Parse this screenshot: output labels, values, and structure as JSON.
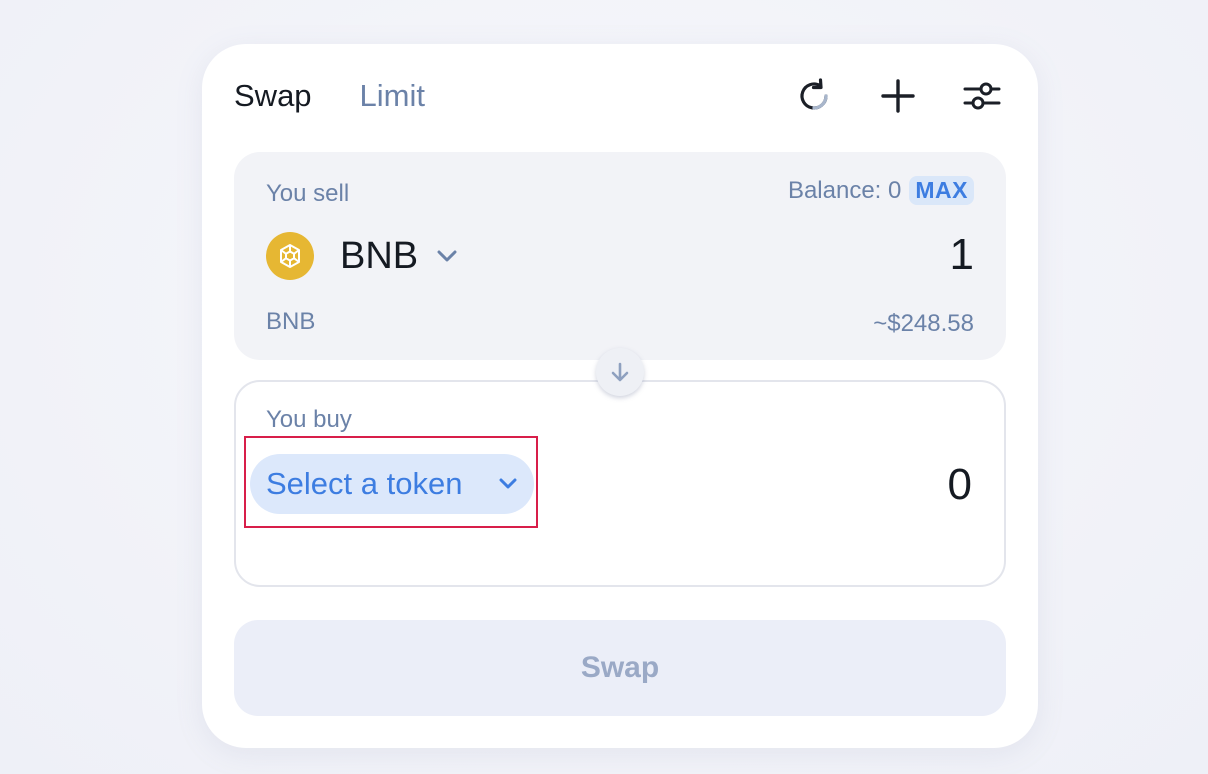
{
  "tabs": [
    {
      "label": "Swap",
      "active": true
    },
    {
      "label": "Limit",
      "active": false
    }
  ],
  "toolbar": {
    "icons": [
      "refresh-icon",
      "plus-icon",
      "settings-sliders-icon"
    ]
  },
  "sell": {
    "label": "You sell",
    "balance_text": "Balance: 0",
    "max_label": "MAX",
    "token_symbol": "BNB",
    "amount": "1",
    "token_name": "BNB",
    "usd_value": "~$248.58"
  },
  "buy": {
    "label": "You buy",
    "select_label": "Select a token",
    "amount": "0"
  },
  "swap_button": {
    "label": "Swap"
  },
  "colors": {
    "accent": "#3d7de1",
    "muted": "#6b82a8",
    "highlight_outline": "#d81e4a",
    "bnb_gold": "#e6b733"
  }
}
